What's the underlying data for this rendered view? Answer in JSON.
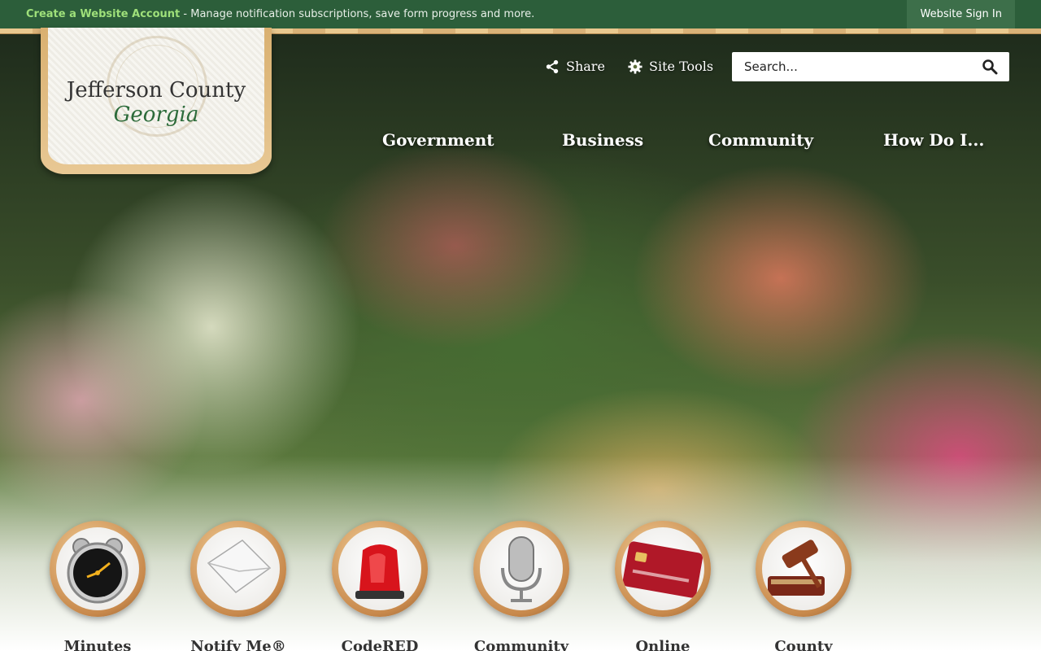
{
  "topbar": {
    "create_account": "Create a Website Account",
    "message": " - Manage notification subscriptions, save form progress and more.",
    "sign_in": "Website Sign In"
  },
  "logo": {
    "title": "Jefferson County",
    "subtitle": "Georgia"
  },
  "utility": {
    "share": "Share",
    "site_tools": "Site Tools"
  },
  "search": {
    "placeholder": "Search..."
  },
  "nav": {
    "items": [
      "Government",
      "Business",
      "Community",
      "How Do I..."
    ]
  },
  "quick_links": [
    {
      "label": "Minutes",
      "icon": "alarm-clock-icon"
    },
    {
      "label": "Notify Me®",
      "icon": "envelope-icon"
    },
    {
      "label": "CodeRED",
      "icon": "siren-light-icon"
    },
    {
      "label": "Community",
      "icon": "microphone-icon"
    },
    {
      "label": "Online",
      "icon": "credit-card-icon"
    },
    {
      "label": "County",
      "icon": "gavel-icon"
    }
  ],
  "colors": {
    "topbar_bg": "#2c5e3a",
    "accent_green": "#9fe07a",
    "wood": "#d9b070"
  }
}
